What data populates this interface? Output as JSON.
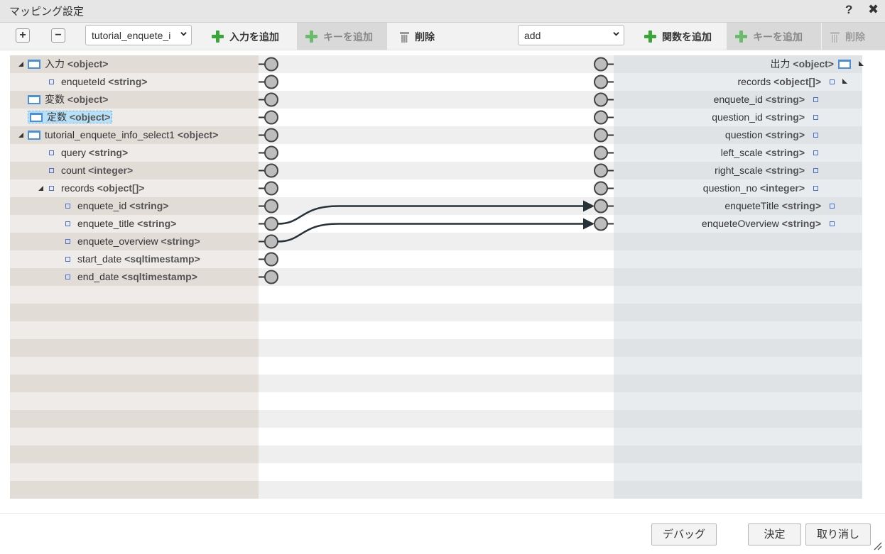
{
  "window": {
    "title": "マッピング設定",
    "help": "?",
    "close": "✖"
  },
  "toolbar": {
    "expand_label": "+",
    "collapse_label": "−",
    "input_select_value": "tutorial_enquete_i",
    "add_input_label": "入力を追加",
    "add_key_label_left": "キーを追加",
    "delete_label_left": "削除",
    "function_select_value": "add",
    "add_function_label": "関数を追加",
    "add_key_label_right": "キーを追加",
    "delete_label_right": "削除"
  },
  "left_tree": [
    {
      "name": "入力",
      "type": "<object>",
      "level": 0,
      "kind": "object",
      "expanded": true
    },
    {
      "name": "enqueteId",
      "type": "<string>",
      "level": 1,
      "kind": "leaf"
    },
    {
      "name": "変数",
      "type": "<object>",
      "level": 0,
      "kind": "object"
    },
    {
      "name": "定数",
      "type": "<object>",
      "level": 0,
      "kind": "object",
      "selected": true
    },
    {
      "name": "tutorial_enquete_info_select1",
      "type": "<object>",
      "level": 0,
      "kind": "object",
      "expanded": true
    },
    {
      "name": "query",
      "type": "<string>",
      "level": 1,
      "kind": "leaf"
    },
    {
      "name": "count",
      "type": "<integer>",
      "level": 1,
      "kind": "leaf"
    },
    {
      "name": "records",
      "type": "<object[]>",
      "level": 1,
      "kind": "leaf",
      "expanded": true
    },
    {
      "name": "enquete_id",
      "type": "<string>",
      "level": 2,
      "kind": "leaf"
    },
    {
      "name": "enquete_title",
      "type": "<string>",
      "level": 2,
      "kind": "leaf"
    },
    {
      "name": "enquete_overview",
      "type": "<string>",
      "level": 2,
      "kind": "leaf"
    },
    {
      "name": "start_date",
      "type": "<sqltimestamp>",
      "level": 2,
      "kind": "leaf"
    },
    {
      "name": "end_date",
      "type": "<sqltimestamp>",
      "level": 2,
      "kind": "leaf"
    }
  ],
  "right_tree": [
    {
      "name": "出力",
      "type": "<object>",
      "level": 0,
      "kind": "object",
      "expanded": true
    },
    {
      "name": "records",
      "type": "<object[]>",
      "level": 1,
      "kind": "leaf",
      "expanded": true
    },
    {
      "name": "enquete_id",
      "type": "<string>",
      "level": 2,
      "kind": "leaf"
    },
    {
      "name": "question_id",
      "type": "<string>",
      "level": 2,
      "kind": "leaf"
    },
    {
      "name": "question",
      "type": "<string>",
      "level": 2,
      "kind": "leaf"
    },
    {
      "name": "left_scale",
      "type": "<string>",
      "level": 2,
      "kind": "leaf"
    },
    {
      "name": "right_scale",
      "type": "<string>",
      "level": 2,
      "kind": "leaf"
    },
    {
      "name": "question_no",
      "type": "<integer>",
      "level": 2,
      "kind": "leaf"
    },
    {
      "name": "enqueteTitle",
      "type": "<string>",
      "level": 1,
      "kind": "leaf"
    },
    {
      "name": "enqueteOverview",
      "type": "<string>",
      "level": 1,
      "kind": "leaf"
    }
  ],
  "mappings": [
    {
      "from": 9,
      "to": 8
    },
    {
      "from": 10,
      "to": 9
    }
  ],
  "footer": {
    "debug_label": "デバッグ",
    "ok_label": "決定",
    "cancel_label": "取り消し"
  },
  "colors": {
    "accent_green": "#3aa63a",
    "object_icon_blue": "#4a90d9",
    "selection_blue": "#b8e1f7",
    "wire": "#263238"
  }
}
